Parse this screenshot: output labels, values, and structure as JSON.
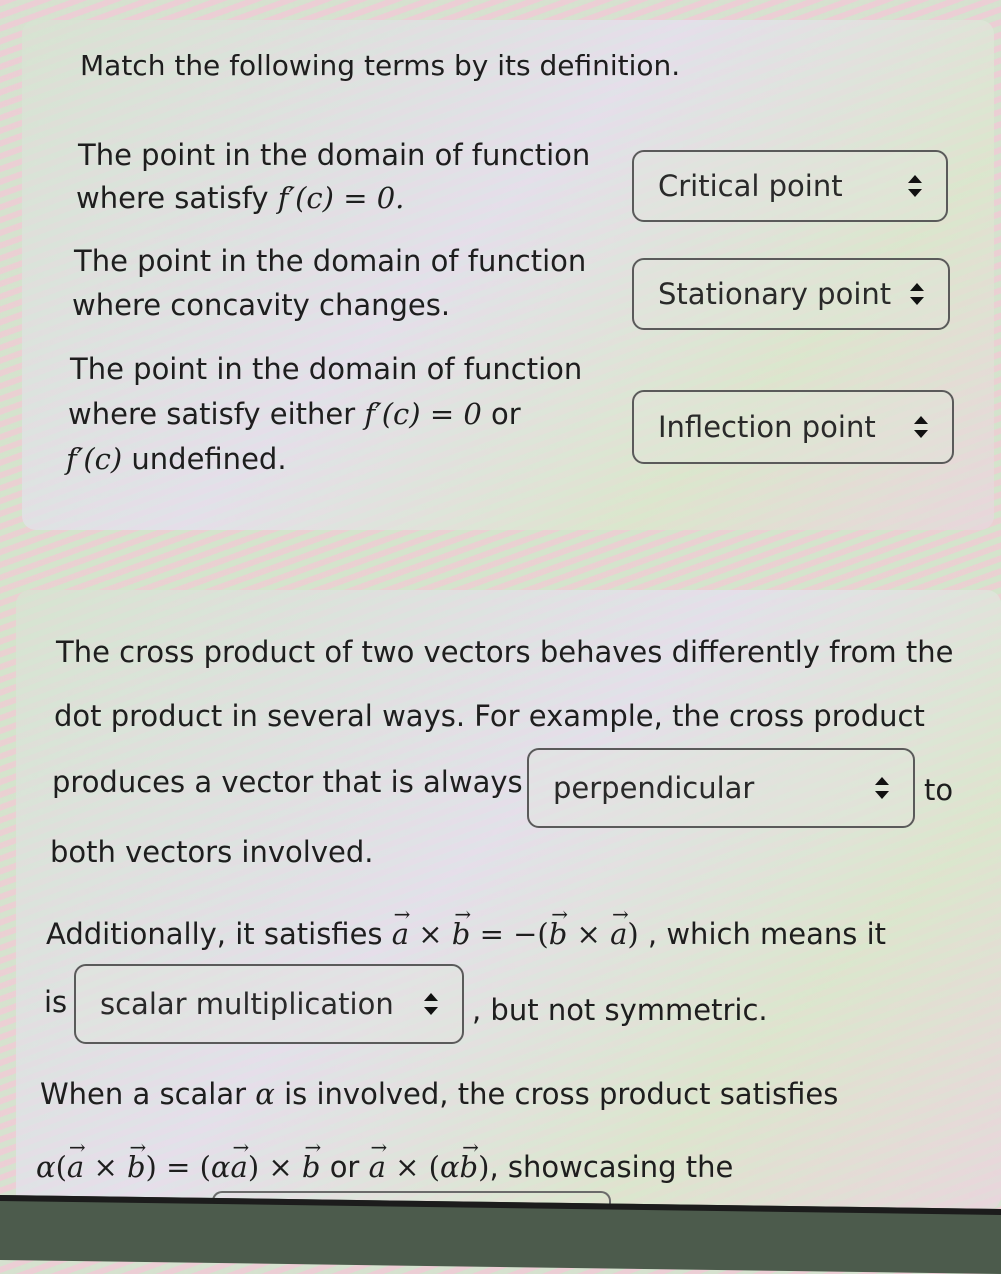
{
  "matching_question": {
    "prompt": "Match the following terms by its definition.",
    "items": [
      {
        "definition_line1": "The point in the domain of function",
        "definition_line2_text": "where satisfy",
        "definition_math": "f′(c) = 0.",
        "selected": "Critical point"
      },
      {
        "definition_line1": "The point in the domain of function",
        "definition_line2_text": "where concavity changes.",
        "selected": "Stationary point"
      },
      {
        "definition_line1": "The point in the domain of function",
        "definition_line2_text": "where satisfy either",
        "definition_math_a": "f′(c) = 0",
        "definition_or": "or",
        "definition_math_b": "f′(c)",
        "definition_line3_text": "undefined.",
        "selected": "Inflection point"
      }
    ]
  },
  "cloze_question": {
    "para1_line1": "The cross product of two vectors behaves differently from the",
    "para1_line2": "dot product in several ways. For example, the cross product",
    "para1_line3_before": "produces a vector that is always",
    "dropdown1_selected": "perpendicular",
    "para1_line3_after": "to",
    "para1_line4": "both vectors involved.",
    "para2_before": "Additionally, it satisfies",
    "para2_math": {
      "a": "a",
      "times": "×",
      "b": "b",
      "eq": "= −(",
      "b2": "b",
      "times2": "×",
      "a2": "a",
      "close": ")"
    },
    "para2_after": ", which means it",
    "para2_line2_before": "is",
    "dropdown2_selected": "scalar multiplication",
    "para2_line2_after": ", but not symmetric.",
    "para3_line1_before": "When a scalar",
    "para3_alpha": "α",
    "para3_line1_after": "is involved, the cross product satisfies",
    "para3_math": {
      "alpha": "α",
      "open": "(",
      "a": "a",
      "times": "×",
      "b": "b",
      "close_eq": ") = (",
      "alpha2": "α",
      "a2": "a",
      "close2": ")",
      "times2": "×",
      "b2": "b",
      "or": "or",
      "a3": "a",
      "times3": "×",
      "open3": "(",
      "alpha3": "α",
      "b3": "b",
      "close3": ")"
    },
    "para3_line2_after": ", showcasing the"
  }
}
